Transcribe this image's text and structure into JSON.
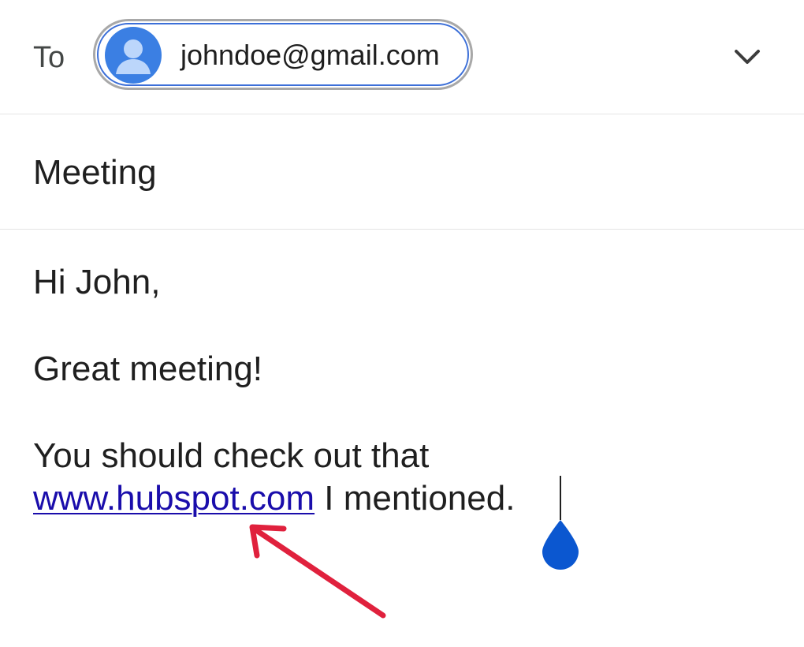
{
  "compose": {
    "to": {
      "label": "To",
      "recipient_email": "johndoe@gmail.com",
      "expand_icon": "chevron-down-icon"
    },
    "subject": "Meeting",
    "body": {
      "greeting": "Hi John,",
      "line2": "Great meeting!",
      "line3": "You should check out that",
      "link_text": "www.hubspot.com",
      "line4_rest": " I mentioned."
    }
  },
  "colors": {
    "avatar": "#3b7fe3",
    "link": "#1a0dab",
    "cursor_handle": "#0b57d0",
    "arrow": "#e0213d"
  }
}
